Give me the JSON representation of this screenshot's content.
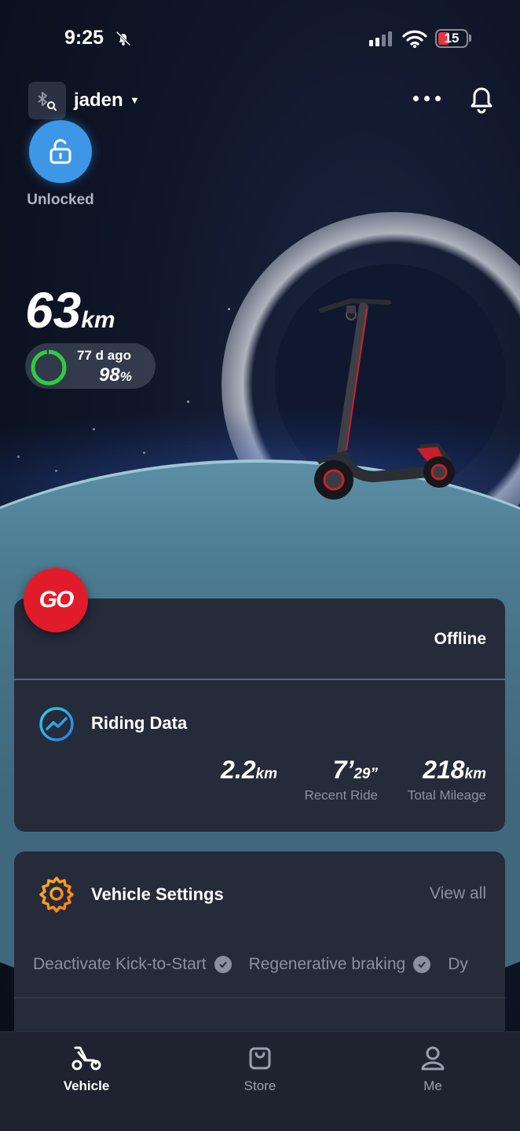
{
  "status_bar": {
    "time": "9:25",
    "battery_level": "15"
  },
  "header": {
    "user_name": "jaden"
  },
  "lock": {
    "label": "Unlocked"
  },
  "range": {
    "value": "63",
    "unit": "km"
  },
  "battery": {
    "last_charged": "77 d ago",
    "percent": "98",
    "percent_unit": "%",
    "level": 0.98
  },
  "go_card": {
    "go_label": "GO",
    "connection_status": "Offline"
  },
  "riding_data": {
    "title": "Riding Data",
    "distance_value": "2.2",
    "distance_unit": "km",
    "time_value": "7’",
    "time_seconds": "29”",
    "recent_ride_label": "Recent Ride",
    "total_value": "218",
    "total_unit": "km",
    "total_label": "Total Mileage"
  },
  "vehicle_settings": {
    "title": "Vehicle Settings",
    "view_all": "View all",
    "chips": [
      "Deactivate Kick-to-Start",
      "Regenerative braking",
      "Dy"
    ]
  },
  "tabbar": {
    "vehicle": "Vehicle",
    "store": "Store",
    "me": "Me"
  },
  "colors": {
    "accent_blue": "#3d97e6",
    "go_red": "#e21b2a",
    "card_bg": "#262b3a",
    "battery_green": "#2ecc40"
  }
}
